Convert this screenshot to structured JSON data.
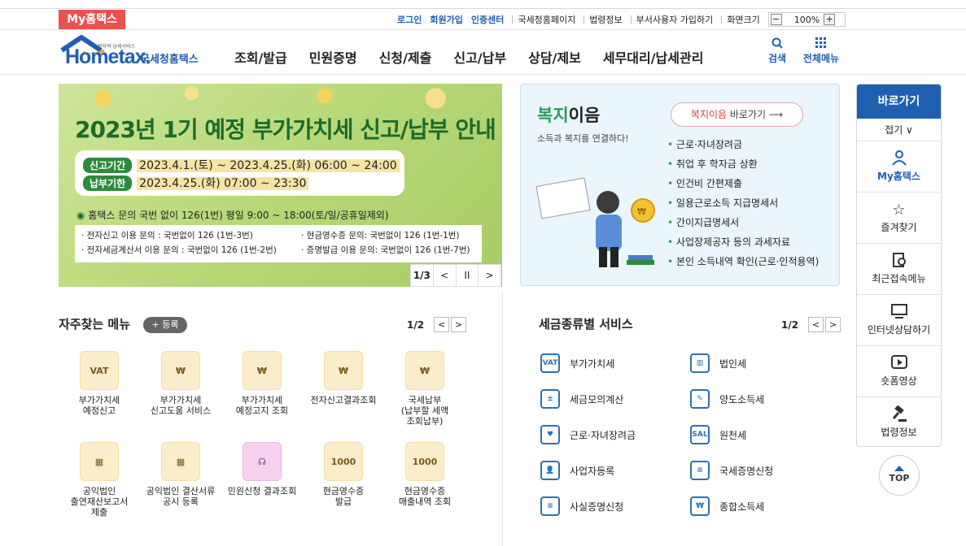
{
  "topbar": {
    "my_tab": "My홈택스",
    "links": [
      "로그인",
      "회원가입",
      "인증센터"
    ],
    "plain_links": [
      "국세청홈페이지",
      "법령정보",
      "부서사용자 가입하기",
      "화면크기"
    ],
    "zoom_minus": "−",
    "zoom_value": "100%",
    "zoom_plus": "+"
  },
  "header": {
    "logo_main": "Hometax.",
    "logo_sub": "국세청홈택스",
    "logo_tiny": "전자적 납세서비스",
    "gnb": [
      "조회/발급",
      "민원증명",
      "신청/제출",
      "신고/납부",
      "상담/제보",
      "세무대리/납세관리"
    ],
    "search_label": "검색",
    "allmenu_label": "전체메뉴"
  },
  "banner": {
    "title": "2023년 1기 예정 부가가치세 신고/납부 안내",
    "period_label": "신고기간",
    "period_value": "2023.4.1.(토) ~ 2023.4.25.(화) 06:00 ~ 24:00",
    "pay_label": "납부기한",
    "pay_value": "2023.4.25.(화) 07:00 ~ 23:30",
    "phone_line": "홈택스 문의 국번 없이 126(1번) 평일 9:00 ~ 18:00(토/일/공휴일제외)",
    "inq_1": "· 전자신고 이용 문의 : 국번없이 126 (1번-3번)",
    "inq_2": "· 현금영수증 문의: 국번없이 126 (1번-1번)",
    "inq_3": "· 전자세금계산서 이용 문의 : 국번없이 126 (1번-2번)",
    "inq_4": "· 증명발급 이용 문의: 국번없이 126 (1번-7번)",
    "page": "1/3",
    "prev": "<",
    "pause": "II",
    "next": ">"
  },
  "welfare": {
    "title_green": "복지",
    "title_rest": "이음",
    "subtitle": "소득과 복지를 연결하다!",
    "go_red": "복지이음",
    "go_rest": " 바로가기",
    "items": [
      "근로·자녀장려금",
      "취업 후 학자금 상환",
      "인건비 간편제출",
      "일용근로소득 지급명세서",
      "간이지급명세서",
      "사업장제공자 등의 과세자료",
      "본인 소득내역 확인(근로·인적용역)"
    ]
  },
  "quick": {
    "head": "바로가기",
    "fold": "접기 ∨",
    "items": [
      {
        "label": "My홈택스",
        "icon": "person-icon"
      },
      {
        "label": "즐겨찾기",
        "icon": "star-icon"
      },
      {
        "label": "최근접속메뉴",
        "icon": "recent-doc-icon"
      },
      {
        "label": "인터넷상담하기",
        "icon": "monitor-chat-icon"
      },
      {
        "label": "숏폼영상",
        "icon": "play-icon"
      },
      {
        "label": "법령정보",
        "icon": "gavel-icon"
      }
    ],
    "top": "TOP"
  },
  "freq": {
    "title": "자주찾는 메뉴",
    "register": "+ 등록",
    "page": "1/2",
    "items": [
      {
        "label": "부가가치세\n예정신고",
        "icon": "VAT"
      },
      {
        "label": "부가가치세\n신고도움 서비스",
        "icon": "₩"
      },
      {
        "label": "부가가치세\n예정고지 조회",
        "icon": "₩"
      },
      {
        "label": "전자신고결과조회",
        "icon": "₩"
      },
      {
        "label": "국세납부\n(납부할 세액\n조회납부)",
        "icon": "₩"
      },
      {
        "label": "공익법인\n출연재산보고서\n제출",
        "icon": "▦"
      },
      {
        "label": "공익법인 결산서류\n공시 등록",
        "icon": "▦"
      },
      {
        "label": "민원신청 결과조회",
        "icon": "☊"
      },
      {
        "label": "현금영수증\n발급",
        "icon": "1000"
      },
      {
        "label": "현금영수증\n매출내역 조회",
        "icon": "1000"
      }
    ]
  },
  "taxsvc": {
    "title": "세금종류별 서비스",
    "page": "1/2",
    "items": [
      {
        "label": "부가가치세",
        "icon": "VAT"
      },
      {
        "label": "법인세",
        "icon": "▥"
      },
      {
        "label": "세금모의계산",
        "icon": "±"
      },
      {
        "label": "양도소득세",
        "icon": "✎"
      },
      {
        "label": "근로·자녀장려금",
        "icon": "♥"
      },
      {
        "label": "원천세",
        "icon": "SAL"
      },
      {
        "label": "사업자등록",
        "icon": "👤"
      },
      {
        "label": "국세증명신청",
        "icon": "≡"
      },
      {
        "label": "사실증명신청",
        "icon": "≡"
      },
      {
        "label": "종합소득세",
        "icon": "₩"
      }
    ]
  }
}
